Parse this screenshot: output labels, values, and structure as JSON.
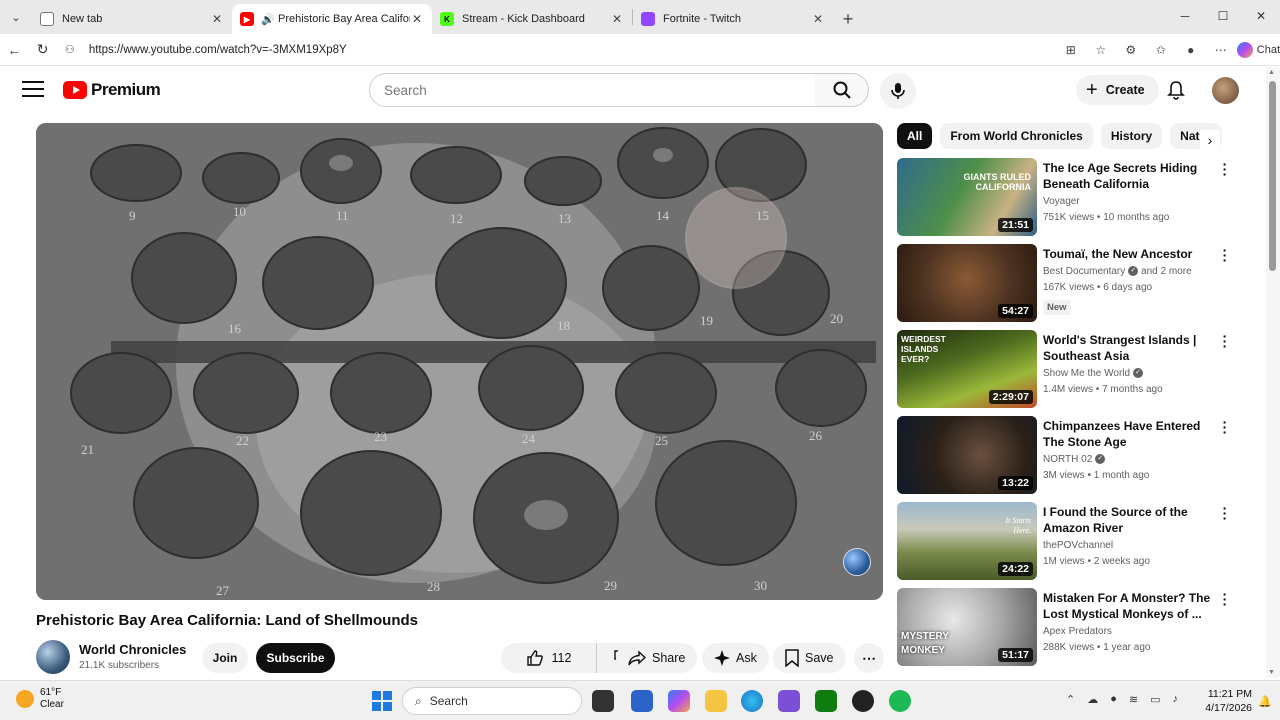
{
  "browser": {
    "tabs": [
      {
        "label": "New tab",
        "icon": "newtab-icon",
        "active": false
      },
      {
        "label": "Prehistoric Bay Area California",
        "icon": "youtube-icon",
        "active": true
      },
      {
        "label": "Stream - Kick Dashboard",
        "icon": "kick-icon",
        "active": false
      },
      {
        "label": "Fortnite - Twitch",
        "icon": "twitch-icon",
        "active": false
      }
    ],
    "url": "https://www.youtube.com/watch?v=-3MXM19Xp8Y",
    "chat_label": "Chat"
  },
  "youtube": {
    "brand": "Premium",
    "search_placeholder": "Search",
    "create_label": "Create"
  },
  "video": {
    "title": "Prehistoric Bay Area California: Land of Shellmounds",
    "channel": "World Chronicles",
    "subscribers": "21.1K subscribers",
    "join_label": "Join",
    "subscribe_label": "Subscribe",
    "likes": "112",
    "share_label": "Share",
    "ask_label": "Ask",
    "save_label": "Save",
    "image_numbers": [
      "9",
      "10",
      "11",
      "12",
      "13",
      "14",
      "15",
      "16",
      "18",
      "19",
      "20",
      "21",
      "22",
      "23",
      "24",
      "25",
      "26",
      "27",
      "28",
      "29",
      "30"
    ]
  },
  "chips": [
    "All",
    "From World Chronicles",
    "History",
    "Natur"
  ],
  "recommendations": [
    {
      "title": "The Ice Age Secrets Hiding Beneath California",
      "channel": "Voyager",
      "verified": false,
      "stats": "751K views • 10 months ago",
      "duration": "21:51",
      "thumb_text": "GIANTS RULED CALIFORNIA",
      "new": false
    },
    {
      "title": "Toumaï, the New Ancestor",
      "channel": "Best Documentary",
      "verified": true,
      "extra": "and 2 more",
      "stats": "167K views • 6 days ago",
      "duration": "54:27",
      "new": true,
      "new_label": "New"
    },
    {
      "title": "World's Strangest Islands | Southeast Asia",
      "channel": "Show Me the World",
      "verified": true,
      "stats": "1.4M views • 7 months ago",
      "duration": "2:29:07",
      "thumb_text": "WEIRDEST ISLANDS EVER?",
      "new": false
    },
    {
      "title": "Chimpanzees Have Entered The Stone Age",
      "channel": "NORTH 02",
      "verified": true,
      "stats": "3M views • 1 month ago",
      "duration": "13:22",
      "new": false
    },
    {
      "title": "I Found the Source of the Amazon River",
      "channel": "thePOVchannel",
      "verified": false,
      "stats": "1M views • 2 weeks ago",
      "duration": "24:22",
      "thumb_text": "It Starts Here.",
      "new": false
    },
    {
      "title": "Mistaken For A Monster? The Lost Mystical Monkeys of ...",
      "channel": "Apex Predators",
      "verified": false,
      "stats": "288K views • 1 year ago",
      "duration": "51:17",
      "thumb_text": "MYSTERY MONKEY",
      "new": false
    }
  ],
  "taskbar": {
    "temp": "61°F",
    "condition": "Clear",
    "search_label": "Search",
    "time": "11:21 PM",
    "date": "4/17/2026"
  },
  "colors": {
    "youtube_red": "#ff0000",
    "subscribe_bg": "#0f0f0f",
    "chip_bg": "#f2f2f2"
  }
}
